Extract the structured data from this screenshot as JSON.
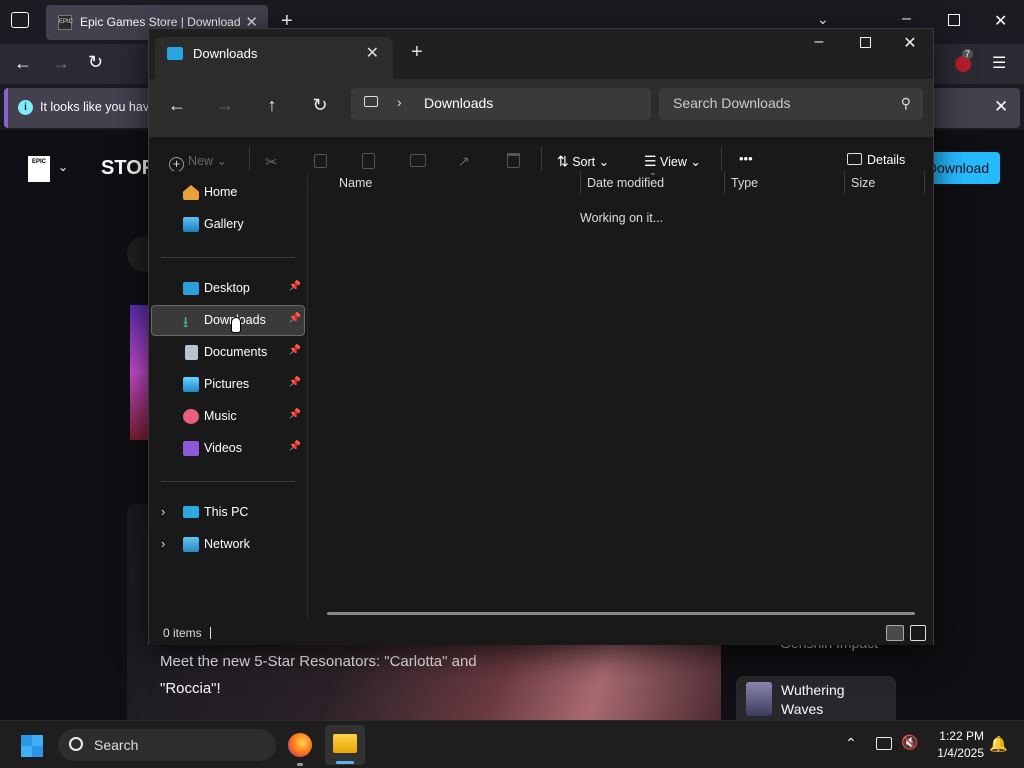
{
  "browser": {
    "tab_title": "Epic Games Store | Download & Play PC Games",
    "tab_favicon_text": "EPIC",
    "notice_text": "It looks like you have",
    "page": {
      "store_label": "STORE",
      "download_button": "Download",
      "epic_logo_text": "EPIC GAMES",
      "promo_text": "Meet the new 5-Star Resonators: \"Carlotta\" and \"Roccia\"!",
      "side_item_top": "Genshin Impact",
      "side_item": "Wuthering Waves",
      "extensions_badge": "7"
    }
  },
  "explorer": {
    "tab_title": "Downloads",
    "address": {
      "location": "Downloads"
    },
    "search": {
      "placeholder": "Search Downloads"
    },
    "toolbar": {
      "new_label": "New",
      "sort_label": "Sort",
      "view_label": "View",
      "more_label": "•••",
      "details_label": "Details"
    },
    "nav": {
      "quick": [
        {
          "label": "Home"
        },
        {
          "label": "Gallery"
        }
      ],
      "pinned": [
        {
          "label": "Desktop"
        },
        {
          "label": "Downloads"
        },
        {
          "label": "Documents"
        },
        {
          "label": "Pictures"
        },
        {
          "label": "Music"
        },
        {
          "label": "Videos"
        }
      ],
      "tree": [
        {
          "label": "This PC"
        },
        {
          "label": "Network"
        }
      ]
    },
    "columns": [
      "Name",
      "Date modified",
      "Type",
      "Size"
    ],
    "status_message": "Working on it...",
    "status_bar": {
      "items": "0 items"
    }
  },
  "taskbar": {
    "search_label": "Search",
    "time": "1:22 PM",
    "date": "1/4/2025"
  },
  "colors": {
    "accent": "#29a5e0",
    "epic_download": "#26bbff",
    "notice_border": "#8a62cf"
  }
}
